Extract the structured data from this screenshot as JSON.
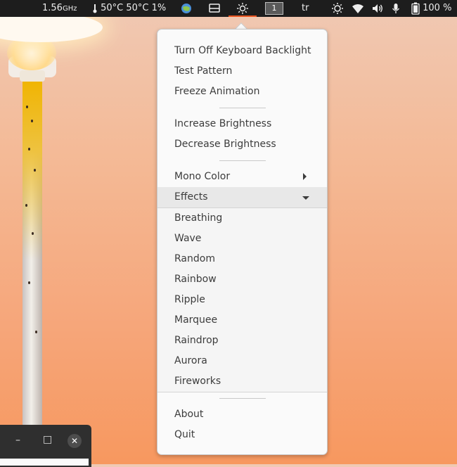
{
  "topbar": {
    "cpu_freq": "1.56",
    "cpu_unit": "GHz",
    "temps": "50°C 50°C 1%",
    "workspace": "1",
    "keyboard_layout": "tr",
    "battery": "100 %"
  },
  "menu": {
    "items": [
      "Turn Off Keyboard Backlight",
      "Test Pattern",
      "Freeze Animation",
      "Increase Brightness",
      "Decrease Brightness",
      "Mono Color",
      "Effects"
    ],
    "effects": [
      "Breathing",
      "Wave",
      "Random",
      "Rainbow",
      "Ripple",
      "Marquee",
      "Raindrop",
      "Aurora",
      "Fireworks"
    ],
    "footer": [
      "About",
      "Quit"
    ]
  },
  "colors": {
    "accent": "#e95420",
    "topbar_bg": "#1d1d1d",
    "menu_bg": "#fafafa"
  }
}
